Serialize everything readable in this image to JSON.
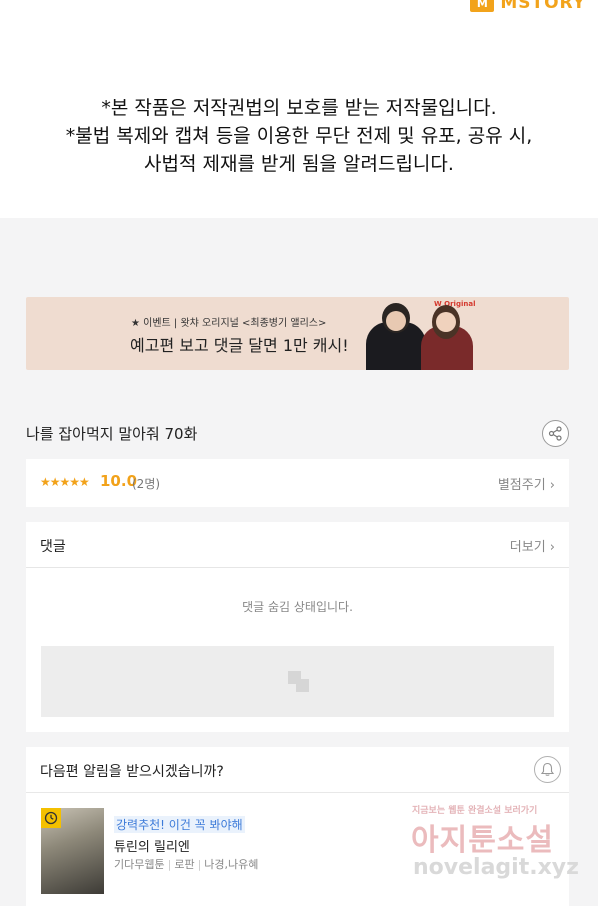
{
  "logo": {
    "text": "MSTORY"
  },
  "notice": {
    "lines": [
      "*본 작품은 저작권법의 보호를 받는 저작물입니다.",
      "*불법 복제와 캡쳐 등을 이용한 무단 전제 및 유포, 공유 시,",
      "사법적 제재를 받게 됨을 알려드립니다."
    ]
  },
  "banner": {
    "small_text": "★ 이벤트 | 왓챠 오리지널 <최종병기 앨리스>",
    "big_text": "예고편 보고 댓글 달면 1만 캐시!",
    "badge": "W Original",
    "bg_color": "#efdcd0"
  },
  "episode": {
    "title": "나를 잡아먹지 말아줘 70화",
    "share_icon": "share-icon"
  },
  "rating": {
    "stars": "★★★★★",
    "score": "10.0",
    "count": "(2명)",
    "rate_link": "별점주기 ›",
    "accent_color": "#f2a21a"
  },
  "comments": {
    "title": "댓글",
    "more_link": "더보기 ›",
    "hidden_message": "댓글 숨김 상태입니다."
  },
  "alarm": {
    "title": "다음편 알림을 받으시겠습니까?",
    "bell_icon": "bell-icon"
  },
  "recommendation": {
    "tag": "강력추천! 이건 꼭 봐야해",
    "title": "튜린의 릴리엔",
    "meta": [
      "기다무웹툰",
      "로판",
      "나경,나유혜"
    ],
    "tag_color": "#3d7bd9"
  },
  "watermark": {
    "top": "지금보는 웹툰 완결소설 보러가기",
    "main": "아지툰소설",
    "url": "novelagit.xyz"
  }
}
